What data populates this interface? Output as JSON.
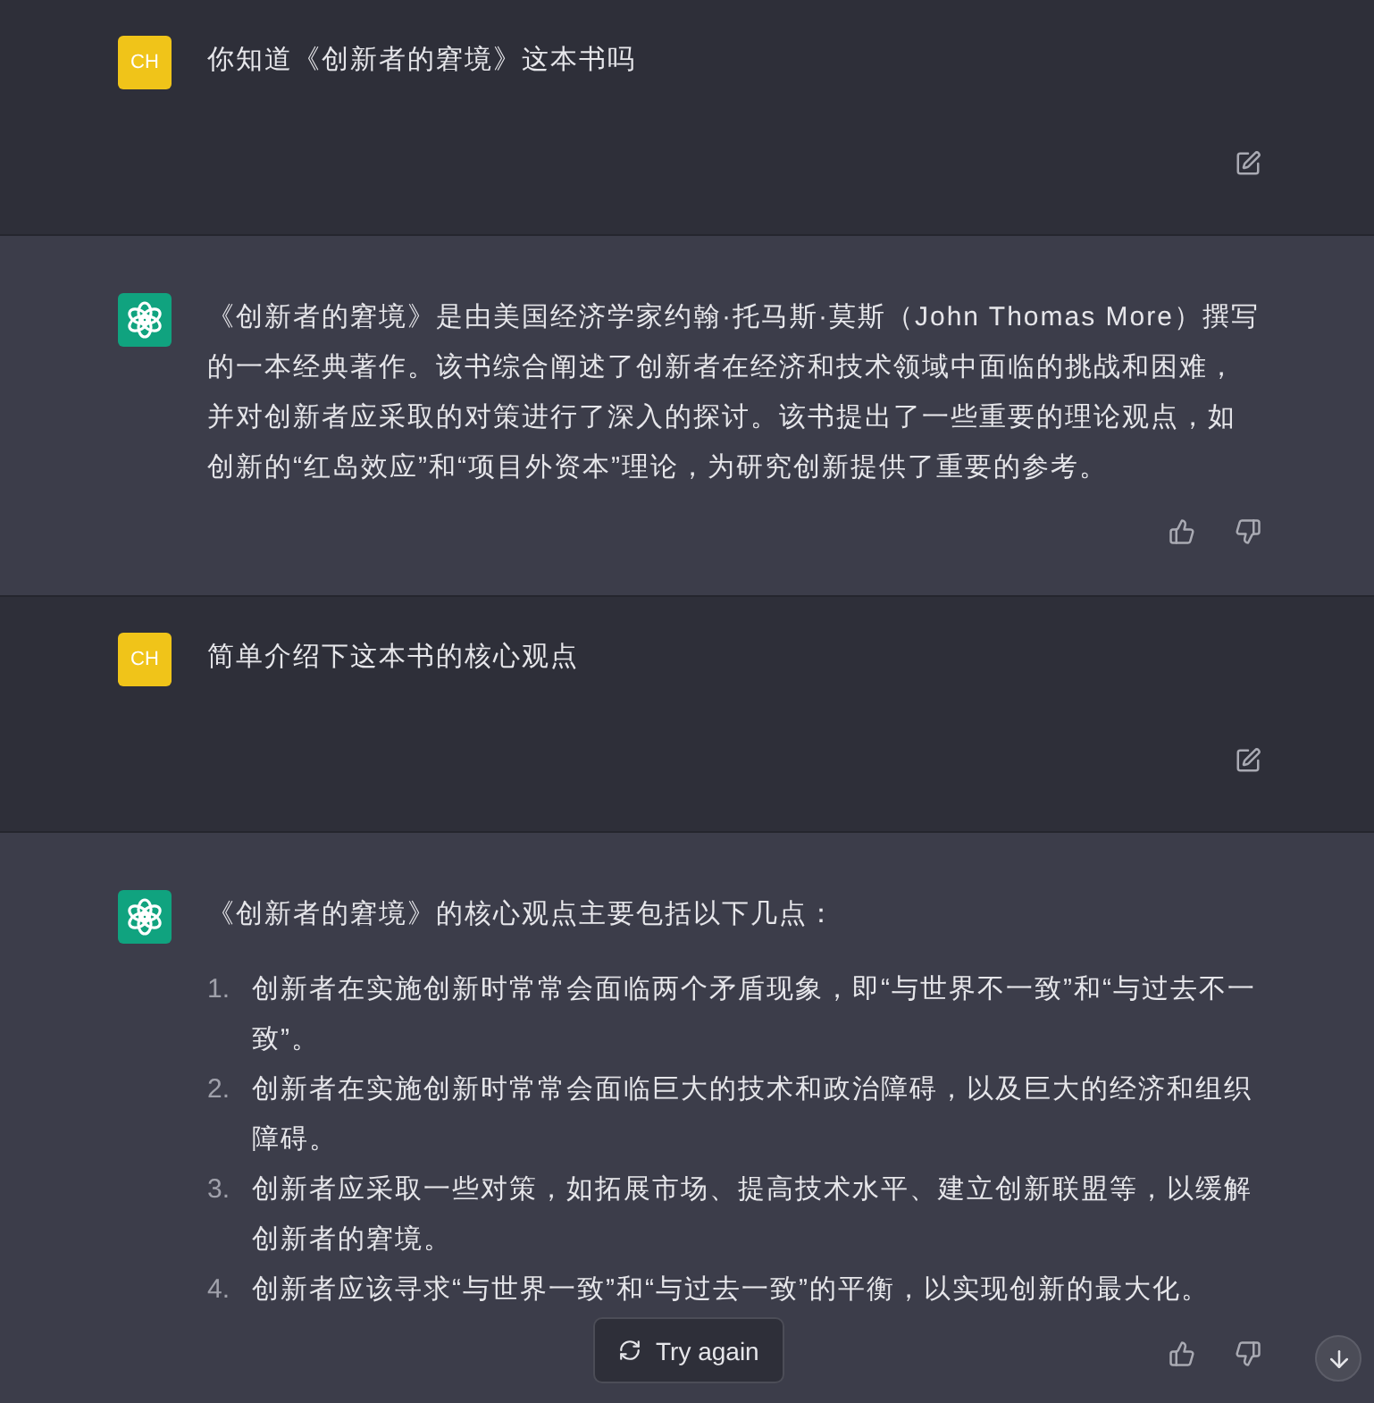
{
  "messages": [
    {
      "kind": "user",
      "avatar": "CH",
      "text": "你知道《创新者的窘境》这本书吗"
    },
    {
      "kind": "assistant",
      "text": "《创新者的窘境》是由美国经济学家约翰·托马斯·莫斯（John Thomas More）撰写的一本经典著作。该书综合阐述了创新者在经济和技术领域中面临的挑战和困难，并对创新者应采取的对策进行了深入的探讨。该书提出了一些重要的理论观点，如创新的“红岛效应”和“项目外资本”理论，为研究创新提供了重要的参考。"
    },
    {
      "kind": "user",
      "avatar": "CH",
      "text": "简单介绍下这本书的核心观点"
    },
    {
      "kind": "assistant",
      "text": "《创新者的窘境》的核心观点主要包括以下几点：",
      "list": [
        {
          "number": "1.",
          "text": "创新者在实施创新时常常会面临两个矛盾现象，即“与世界不一致”和“与过去不一致”。"
        },
        {
          "number": "2.",
          "text": "创新者在实施创新时常常会面临巨大的技术和政治障碍，以及巨大的经济和组织障碍。"
        },
        {
          "number": "3.",
          "text": "创新者应采取一些对策，如拓展市场、提高技术水平、建立创新联盟等，以缓解创新者的窘境。"
        },
        {
          "number": "4.",
          "text": "创新者应该寻求“与世界一致”和“与过去一致”的平衡，以实现创新的最大化。"
        }
      ]
    }
  ],
  "try_again": "Try again"
}
